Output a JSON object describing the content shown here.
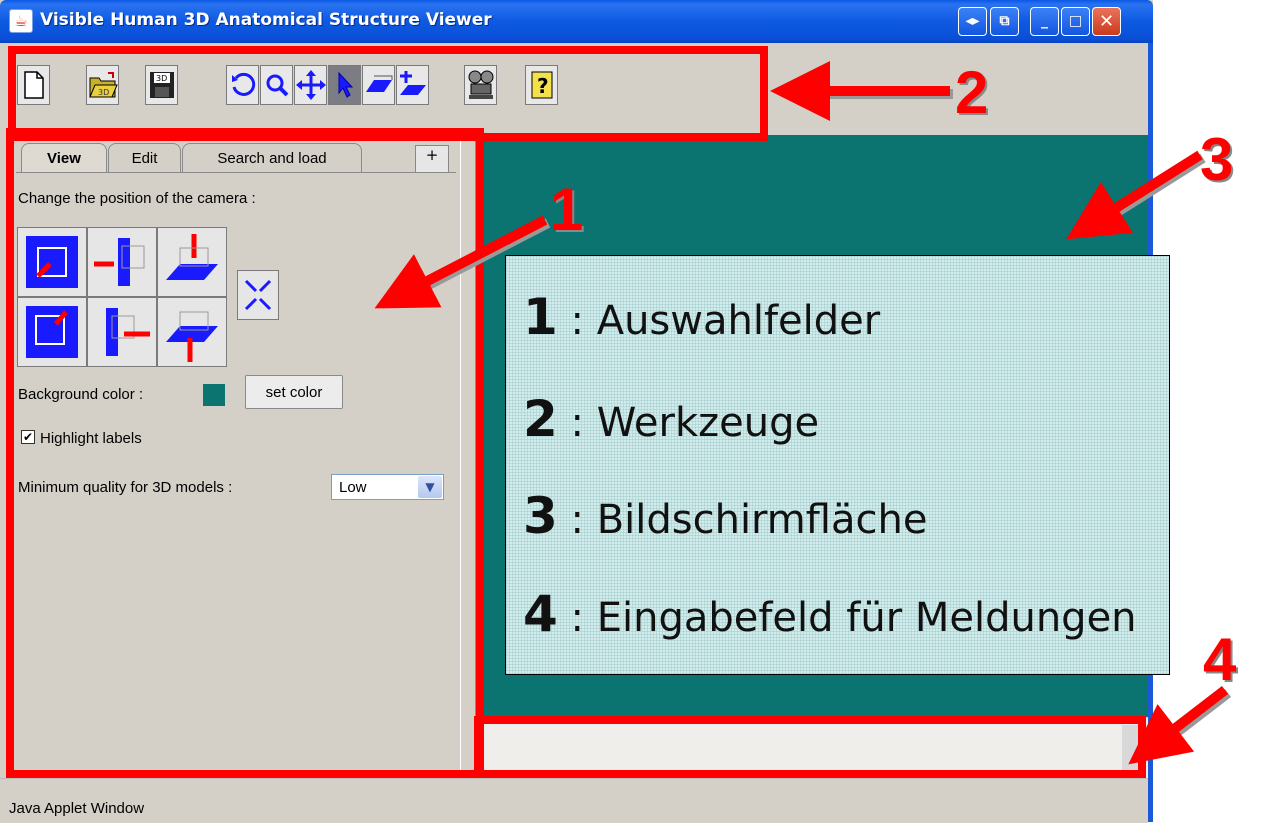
{
  "window": {
    "title": "Visible Human 3D Anatomical Structure Viewer",
    "app_icon": "java-cup-icon",
    "controls": [
      "swap-icon",
      "popout-icon",
      "minimize-icon",
      "maximize-icon",
      "close-icon"
    ],
    "control_glyphs": {
      "swap": "◂▸",
      "popout": "⧉",
      "minimize": "_",
      "maximize": "□",
      "close": "✕"
    }
  },
  "toolbar": {
    "tools": [
      "new-file-icon",
      "open-3d-folder-icon",
      "save-3d-icon",
      "rotate-icon",
      "zoom-icon",
      "pan-icon",
      "select-pointer-icon",
      "plane-icon",
      "add-plane-icon",
      "camera-projector-icon",
      "help-icon"
    ],
    "selected": "select-pointer-icon"
  },
  "left_panel": {
    "tabs": [
      "View",
      "Edit",
      "Search and load"
    ],
    "active_tab": "View",
    "collapse_label": "+",
    "camera_label": "Change the position of the camera :",
    "bg_label": "Background color :",
    "bg_color": "#0b7370",
    "set_color_label": "set color",
    "highlight_label": "Highlight labels",
    "highlight_checked": true,
    "check_glyph": "✔",
    "quality_label": "Minimum quality for 3D models :",
    "quality_value": "Low",
    "quality_arrow": "▼"
  },
  "status": {
    "text": "Java Applet Window"
  },
  "annotations": {
    "numbers": [
      "1",
      "2",
      "3",
      "4"
    ],
    "legend": [
      {
        "num": "1",
        "sep": " : ",
        "text": "Auswahlfelder"
      },
      {
        "num": "2",
        "sep": " : ",
        "text": "Werkzeuge"
      },
      {
        "num": "3",
        "sep": " : ",
        "text": "Bildschirmfläche"
      },
      {
        "num": "4",
        "sep": " : ",
        "text": "Eingabefeld für Meldungen"
      }
    ],
    "accent": "#ff0000"
  }
}
